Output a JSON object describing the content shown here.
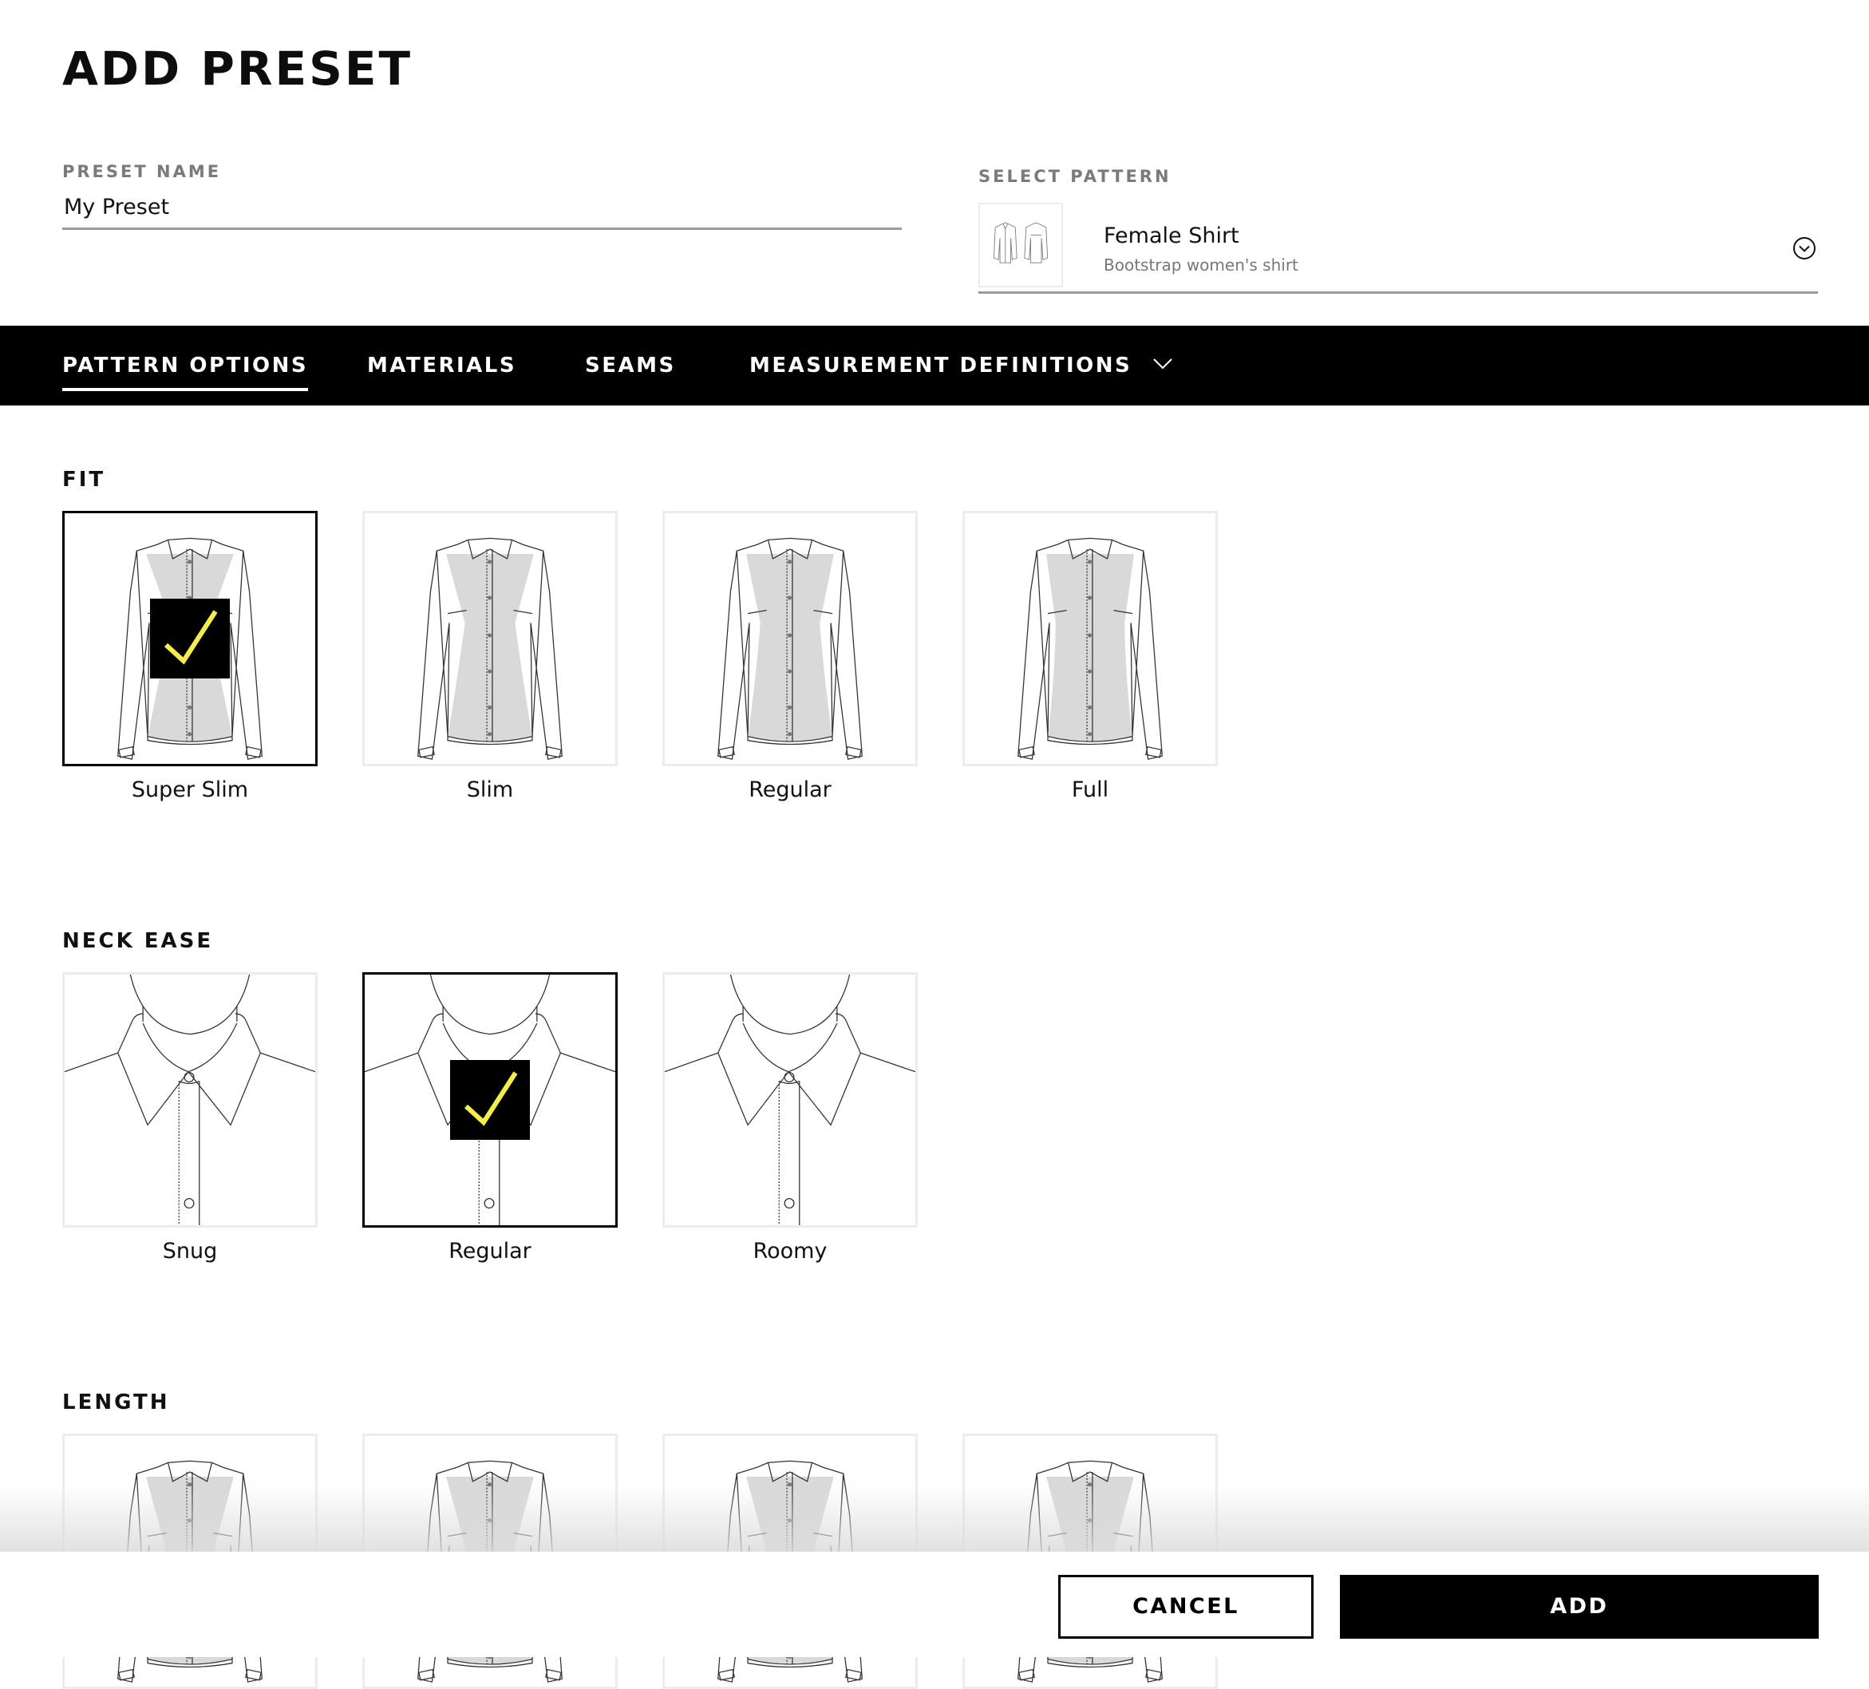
{
  "dialog": {
    "title": "ADD PRESET"
  },
  "preset_name": {
    "label": "PRESET NAME",
    "value": "My Preset"
  },
  "select_pattern": {
    "label": "SELECT PATTERN",
    "selected": {
      "name": "Female Shirt",
      "description": "Bootstrap women's shirt",
      "thumbnail_icon": "shirt-front-back-icon"
    },
    "dropdown_icon": "chevron-down-circle-icon"
  },
  "tabs": [
    {
      "label": "PATTERN OPTIONS",
      "active": true
    },
    {
      "label": "MATERIALS",
      "active": false
    },
    {
      "label": "SEAMS",
      "active": false
    },
    {
      "label": "MEASUREMENT DEFINITIONS",
      "active": false,
      "icon": "chevron-down-icon"
    }
  ],
  "sections": {
    "fit": {
      "title": "FIT",
      "options": [
        {
          "label": "Super Slim",
          "selected": true
        },
        {
          "label": "Slim",
          "selected": false
        },
        {
          "label": "Regular",
          "selected": false
        },
        {
          "label": "Full",
          "selected": false
        }
      ]
    },
    "neck_ease": {
      "title": "NECK EASE",
      "options": [
        {
          "label": "Snug",
          "selected": false
        },
        {
          "label": "Regular",
          "selected": true
        },
        {
          "label": "Roomy",
          "selected": false
        }
      ]
    },
    "length": {
      "title": "LENGTH",
      "options": [
        {
          "selected": false
        },
        {
          "selected": false
        },
        {
          "selected": false
        },
        {
          "selected": false
        }
      ]
    }
  },
  "colors": {
    "check_mark": "#f5ee4a",
    "check_bg": "#000000",
    "garment_fill": "#d9d9d9",
    "accent": "#000000"
  },
  "footer": {
    "cancel_label": "CANCEL",
    "add_label": "ADD"
  }
}
